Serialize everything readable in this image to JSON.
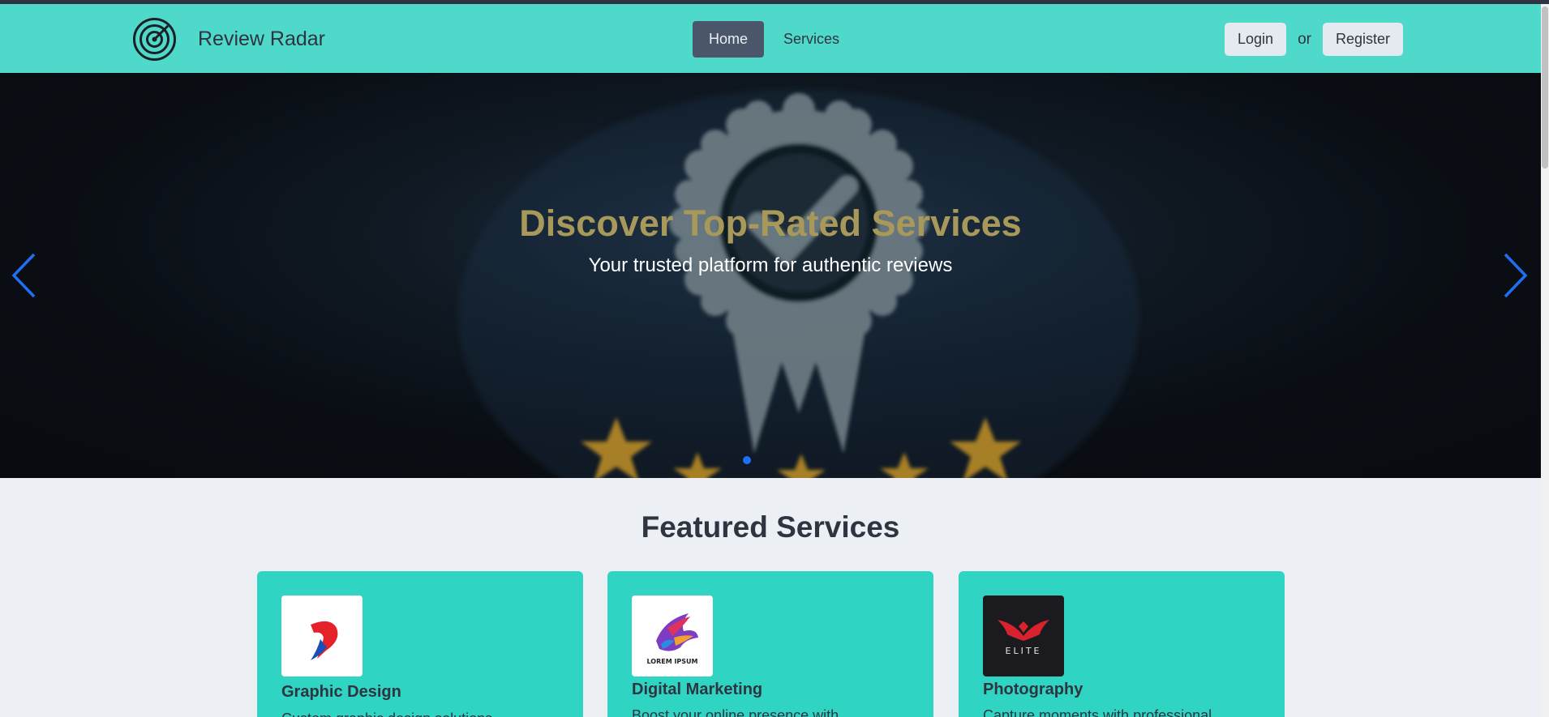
{
  "brand": {
    "name": "Review Radar",
    "logo_icon": "radar-icon"
  },
  "nav": {
    "home": "Home",
    "services": "Services"
  },
  "auth": {
    "login": "Login",
    "or": "or",
    "register": "Register"
  },
  "hero": {
    "title": "Discover Top-Rated Services",
    "subtitle": "Your trusted platform for authentic reviews",
    "prev_icon": "chevron-left-icon",
    "next_icon": "chevron-right-icon",
    "slide_count": 1,
    "active_slide": 1
  },
  "featured": {
    "title": "Featured Services",
    "cards": [
      {
        "title": "Graphic Design",
        "desc": "Custom graphic design solutions",
        "logo_icon": "graphic-design-logo-icon"
      },
      {
        "title": "Digital Marketing",
        "desc": "Boost your online presence with",
        "logo_icon": "bird-logo-icon",
        "logo_text": "LOREM IPSUM"
      },
      {
        "title": "Photography",
        "desc": "Capture moments with professional",
        "logo_icon": "elite-bird-logo-icon",
        "logo_text": "ELITE"
      }
    ]
  },
  "colors": {
    "navbar": "#4fd9cb",
    "card": "#2fd4c2",
    "hero_title": "#a8995a",
    "accent_blue": "#1e6ff5"
  }
}
